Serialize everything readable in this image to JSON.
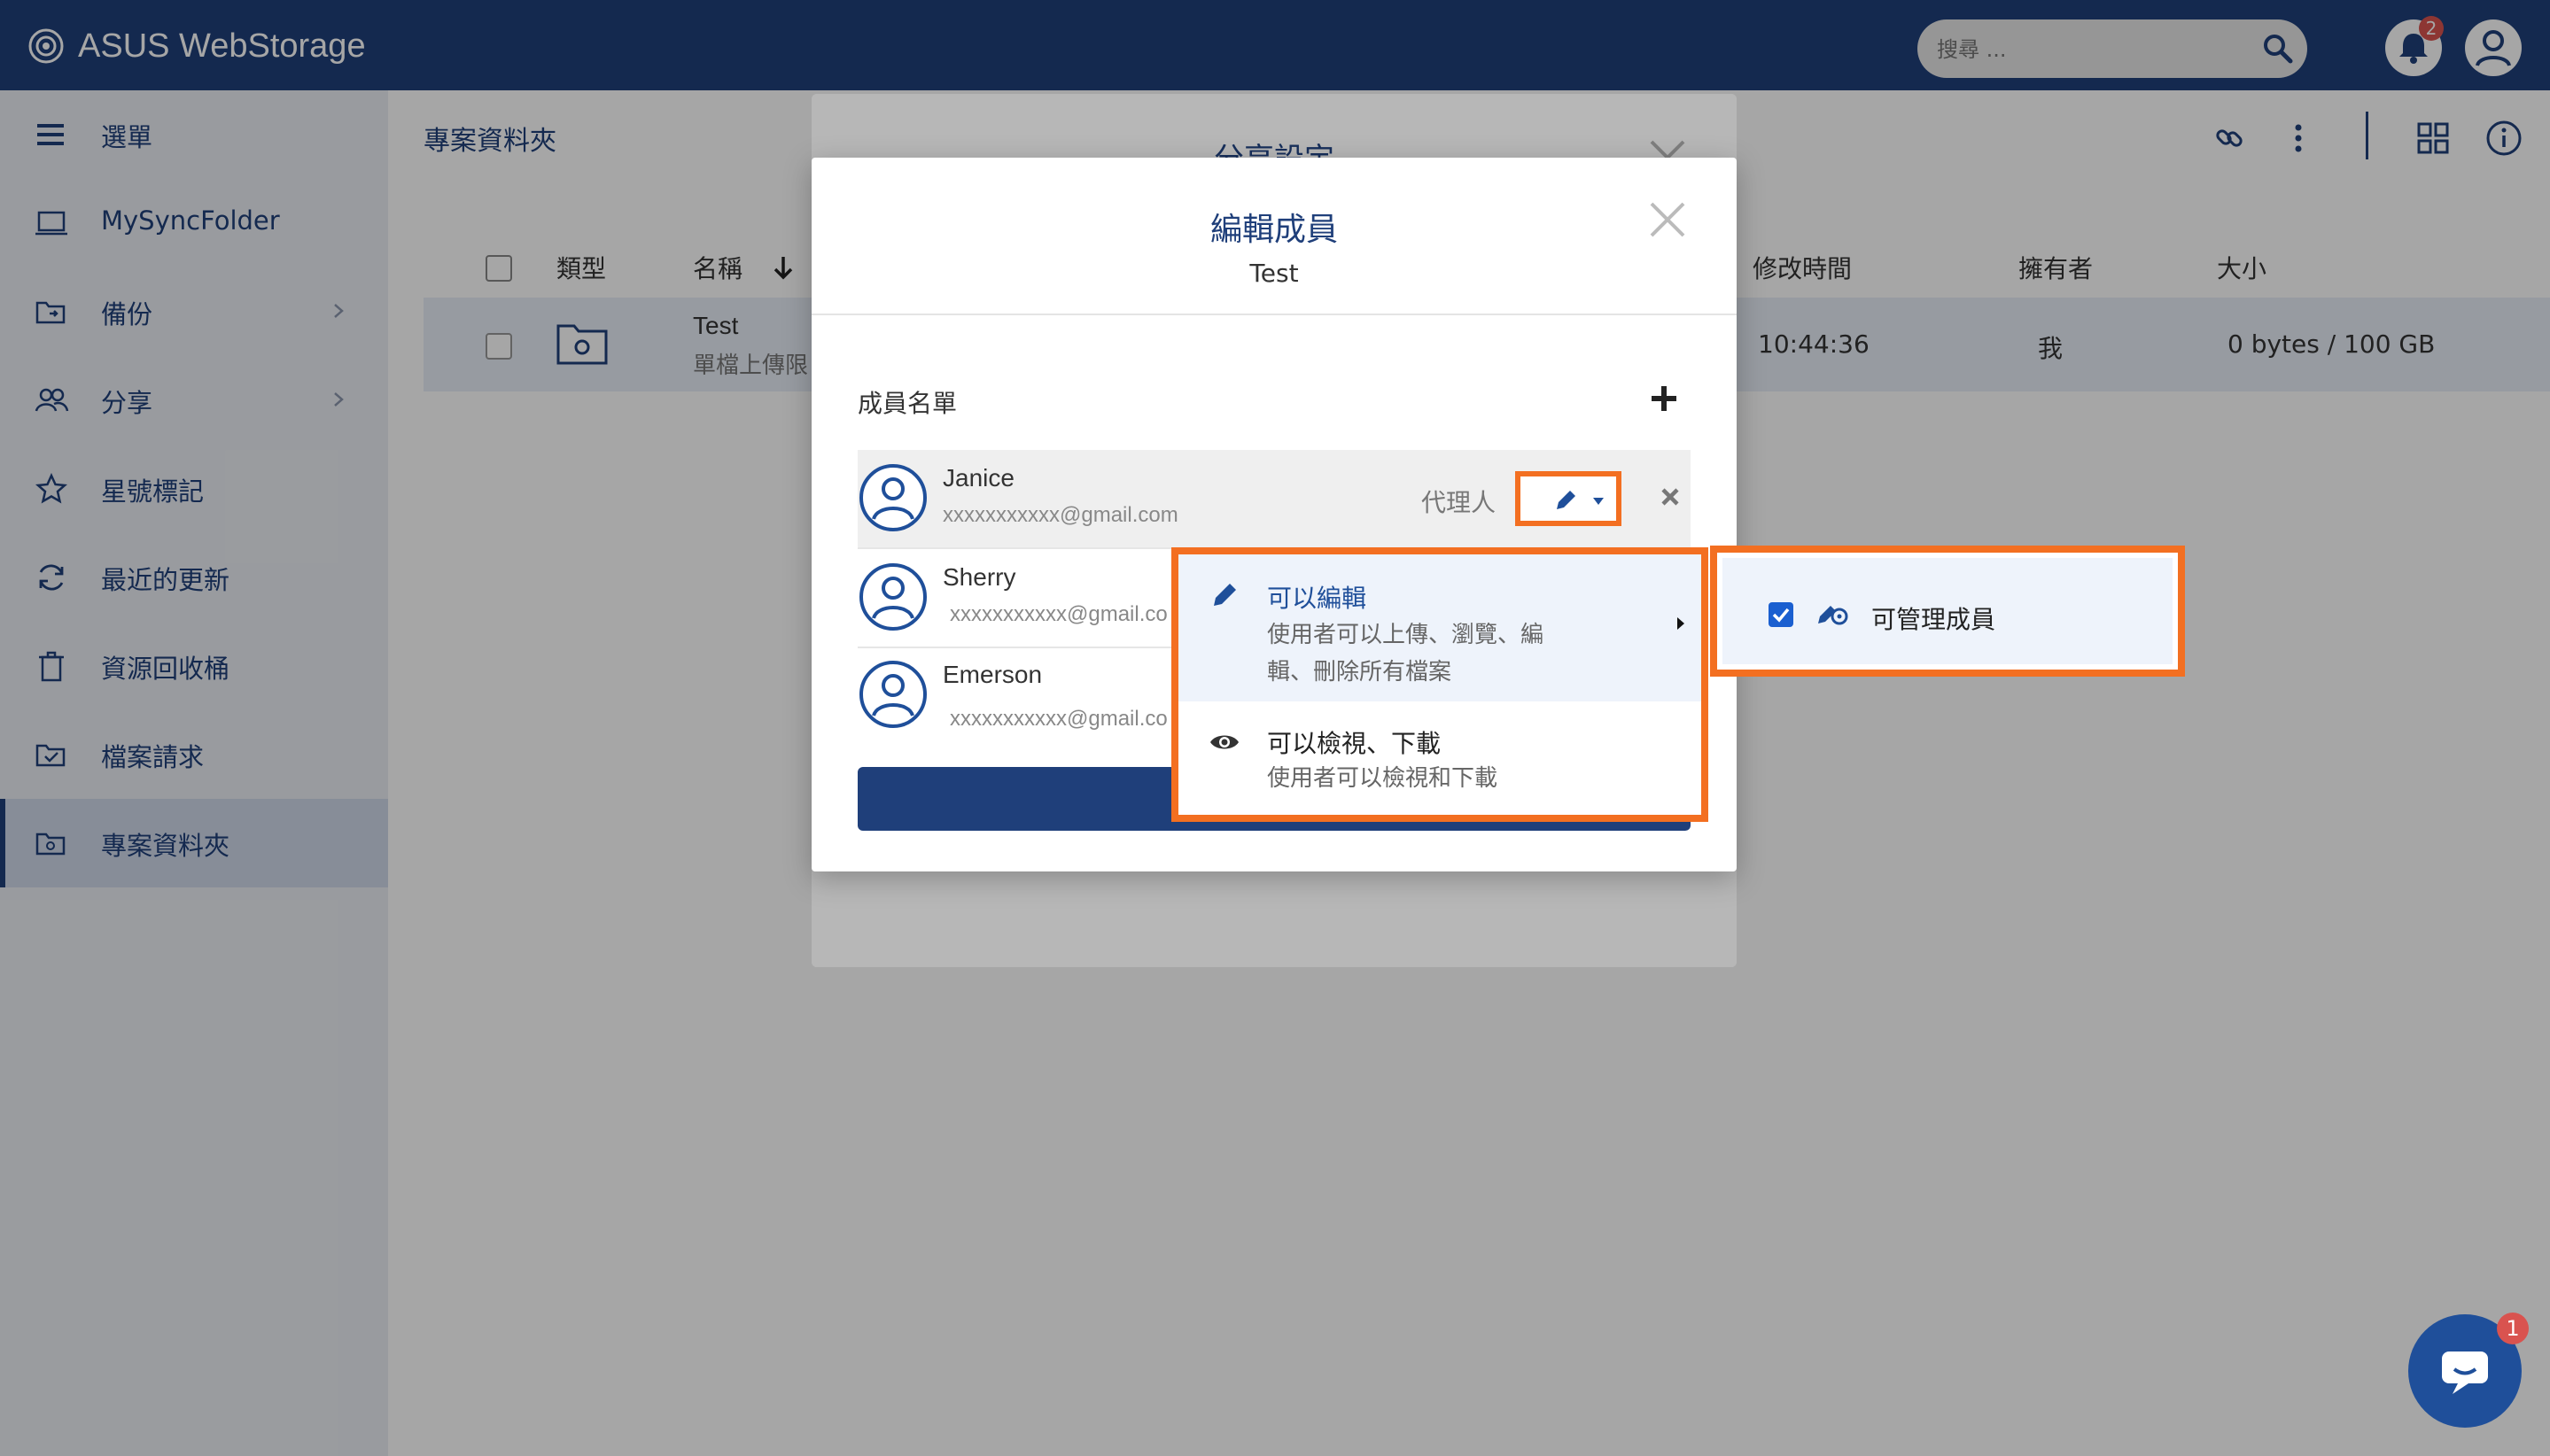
{
  "app": {
    "brand": "ASUS WebStorage"
  },
  "header": {
    "search_placeholder": "搜尋 ...",
    "notification_count": "2",
    "icons": [
      "search-icon",
      "bell-icon",
      "user-avatar-icon"
    ]
  },
  "sidebar": {
    "menu_label": "選單",
    "items": [
      {
        "label": "MySyncFolder",
        "icon": "laptop-icon",
        "has_chevron": false,
        "active": false
      },
      {
        "label": "備份",
        "icon": "backup-folder-icon",
        "has_chevron": true,
        "active": false
      },
      {
        "label": "分享",
        "icon": "people-icon",
        "has_chevron": true,
        "active": false
      },
      {
        "label": "星號標記",
        "icon": "star-icon",
        "has_chevron": false,
        "active": false
      },
      {
        "label": "最近的更新",
        "icon": "refresh-icon",
        "has_chevron": false,
        "active": false
      },
      {
        "label": "資源回收桶",
        "icon": "trash-icon",
        "has_chevron": false,
        "active": false
      },
      {
        "label": "檔案請求",
        "icon": "file-request-icon",
        "has_chevron": false,
        "active": false
      },
      {
        "label": "專案資料夾",
        "icon": "project-folder-icon",
        "has_chevron": false,
        "active": true
      }
    ]
  },
  "main": {
    "breadcrumb_title": "專案資料夾",
    "table": {
      "headers": {
        "type": "類型",
        "name": "名稱",
        "modified": "修改時間",
        "owner": "擁有者",
        "size": "大小"
      },
      "rows": [
        {
          "name": "Test",
          "sub": "單檔上傳限",
          "modified": "10:44:36",
          "owner": "我",
          "size": "0 bytes / 100 GB"
        }
      ]
    }
  },
  "back_dialog": {
    "title": "分享設定"
  },
  "dialog": {
    "title": "編輯成員",
    "subtitle": "Test",
    "members_label": "成員名單",
    "members": [
      {
        "name": "Janice",
        "email": "xxxxxxxxxxx@gmail.com",
        "role": "代理人"
      },
      {
        "name": "Sherry",
        "email": "xxxxxxxxxxx@gmail.co"
      },
      {
        "name": "Emerson",
        "email": "xxxxxxxxxxx@gmail.co"
      }
    ]
  },
  "permission_menu": {
    "items": [
      {
        "title": "可以編輯",
        "desc_line1": "使用者可以上傳、瀏覽、編",
        "desc_line2": "輯、刪除所有檔案",
        "icon": "pencil-icon"
      },
      {
        "title": "可以檢視、下載",
        "desc_line1": "使用者可以檢視和下載",
        "icon": "eye-icon"
      }
    ],
    "submenu": {
      "label": "可管理成員",
      "checked": true,
      "icon": "manage-members-icon"
    }
  },
  "chat": {
    "badge": "1"
  },
  "colors": {
    "brand": "#1f3f7a",
    "highlight": "#f36f21"
  }
}
